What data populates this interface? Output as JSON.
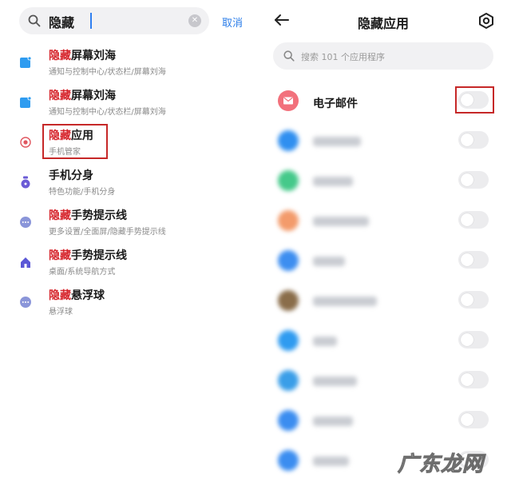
{
  "left": {
    "search_query": "隐藏",
    "cancel_label": "取消",
    "results": [
      {
        "highlight": "隐藏",
        "rest": "屏幕刘海",
        "path": "通知与控制中心/状态栏/屏幕刘海",
        "icon": "notch-settings-icon",
        "color": "#2f9cf0"
      },
      {
        "highlight": "隐藏",
        "rest": "屏幕刘海",
        "path": "通知与控制中心/状态栏/屏幕刘海",
        "icon": "notch-settings-icon",
        "color": "#2f9cf0"
      },
      {
        "highlight": "隐藏",
        "rest": "应用",
        "path": "手机管家",
        "icon": "security-app-icon",
        "color": "#e0565f"
      },
      {
        "highlight": "",
        "rest": "手机分身",
        "path": "特色功能/手机分身",
        "icon": "second-space-icon",
        "color": "#6b5bd6"
      },
      {
        "highlight": "隐藏",
        "rest": "手势提示线",
        "path": "更多设置/全面屏/隐藏手势提示线",
        "icon": "more-settings-icon",
        "color": "#8a95d9"
      },
      {
        "highlight": "隐藏",
        "rest": "手势提示线",
        "path": "桌面/系统导航方式",
        "icon": "home-icon",
        "color": "#5b57d6"
      },
      {
        "highlight": "隐藏",
        "rest": "悬浮球",
        "path": "悬浮球",
        "icon": "more-settings-icon",
        "color": "#8a95d9"
      }
    ]
  },
  "right": {
    "title": "隐藏应用",
    "search_placeholder": "搜索 101 个应用程序",
    "apps": [
      {
        "name": "电子邮件",
        "icon": "email-app-icon",
        "color": "#f2717c",
        "blurred": false
      },
      {
        "name": "",
        "icon": "app-icon",
        "color": "#2f8ff0",
        "blurred": true
      },
      {
        "name": "",
        "icon": "app-icon",
        "color": "#45c98a",
        "blurred": true
      },
      {
        "name": "",
        "icon": "app-icon",
        "color": "#f39b6b",
        "blurred": true
      },
      {
        "name": "",
        "icon": "app-icon",
        "color": "#3d8ef0",
        "blurred": true
      },
      {
        "name": "",
        "icon": "app-icon",
        "color": "#8a6d4a",
        "blurred": true
      },
      {
        "name": "",
        "icon": "app-icon",
        "color": "#2f9bf0",
        "blurred": true
      },
      {
        "name": "",
        "icon": "app-icon",
        "color": "#3a9ee8",
        "blurred": true
      },
      {
        "name": "",
        "icon": "app-icon",
        "color": "#3b8df0",
        "blurred": true
      },
      {
        "name": "",
        "icon": "app-icon",
        "color": "#3b8df0",
        "blurred": true
      }
    ]
  },
  "watermark": "广东龙网"
}
